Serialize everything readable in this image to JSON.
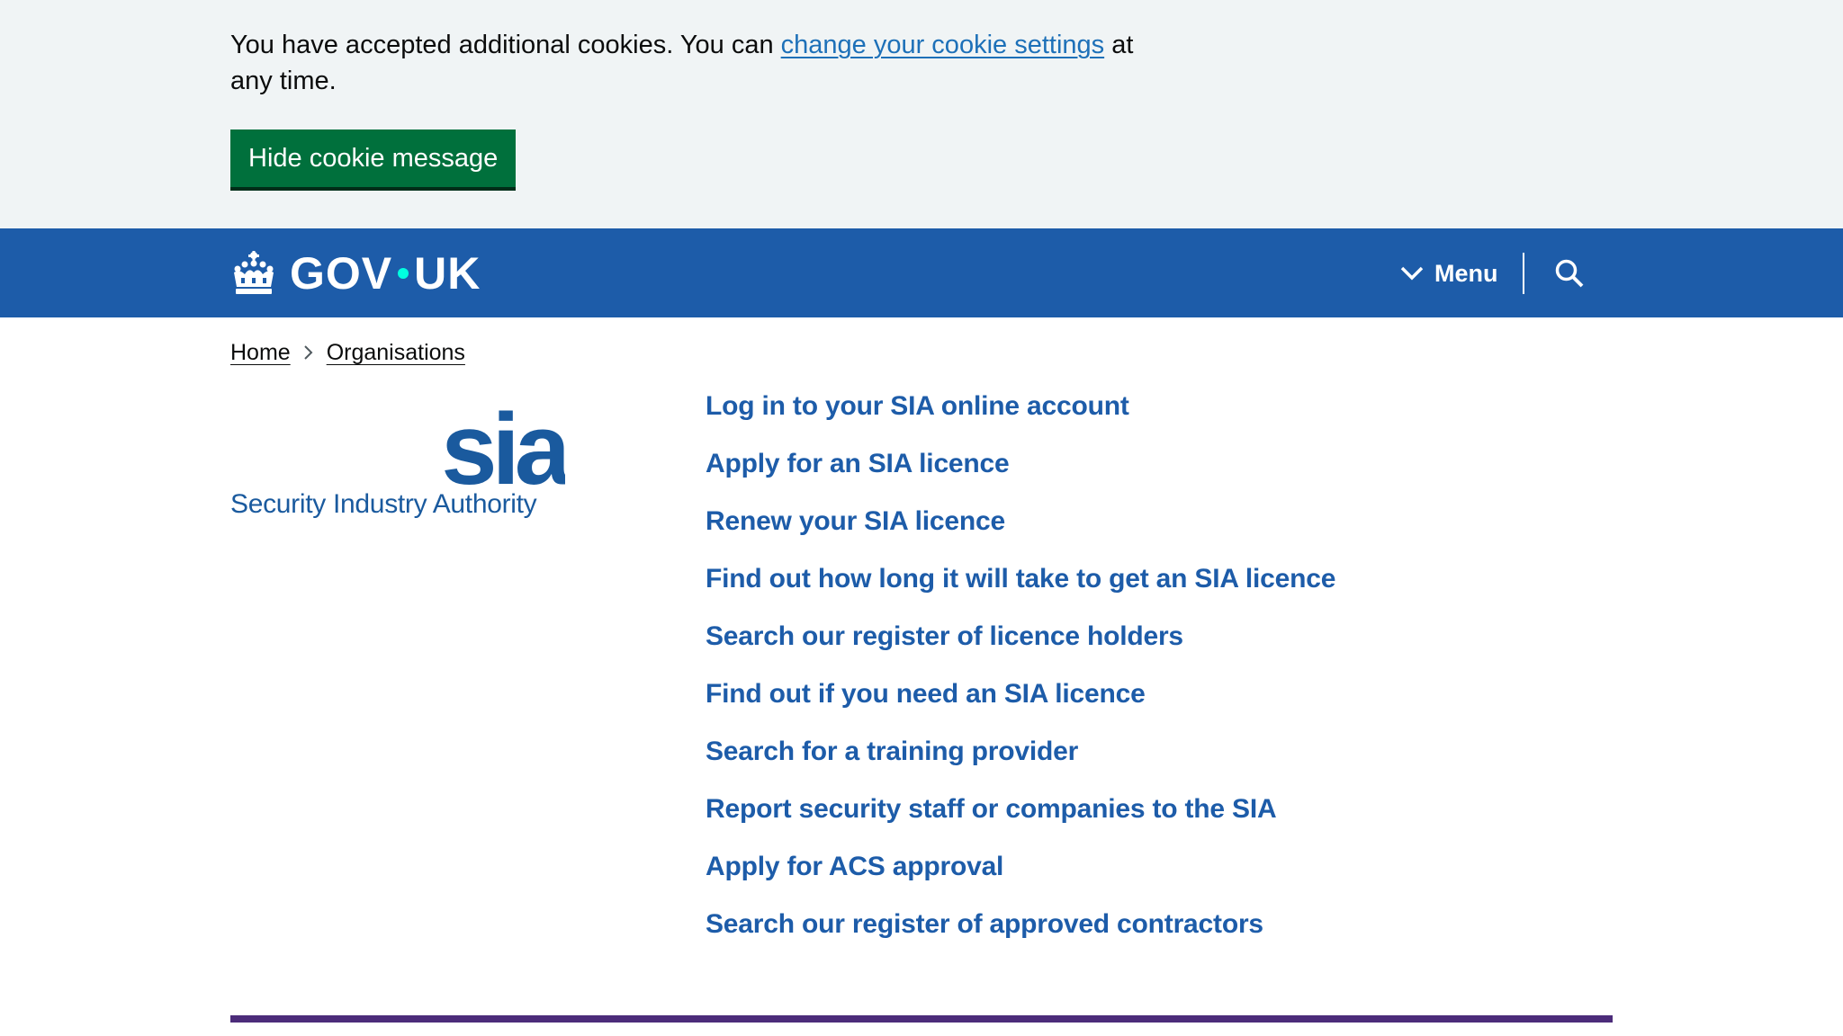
{
  "cookie_banner": {
    "text_before": "You have accepted additional cookies. You can ",
    "link_text": "change your cookie settings",
    "text_after": " at any time.",
    "hide_button": "Hide cookie message"
  },
  "header": {
    "logo_left": "GOV",
    "logo_right": "UK",
    "menu_label": "Menu"
  },
  "breadcrumb": {
    "items": [
      "Home",
      "Organisations"
    ]
  },
  "organisation": {
    "logo_mark": "sia",
    "logo_name": "Security Industry Authority"
  },
  "links": [
    "Log in to your SIA online account",
    "Apply for an SIA licence",
    "Renew your SIA licence",
    "Find out how long it will take to get an SIA licence",
    "Search our register of licence holders",
    "Find out if you need an SIA licence",
    "Search for a training provider",
    "Report security staff or companies to the SIA",
    "Apply for ACS approval",
    "Search our register of approved contractors"
  ],
  "colors": {
    "header_blue": "#1d5ca9",
    "link_blue": "#1d5ca9",
    "button_green": "#00703c",
    "banner_bg": "#f0f4f5",
    "footer_purple": "#4c2c7a"
  }
}
